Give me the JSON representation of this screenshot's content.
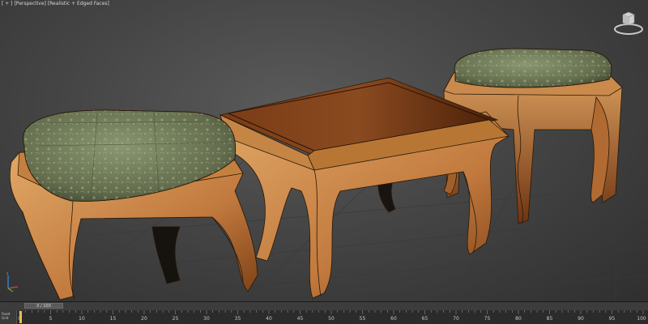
{
  "viewport": {
    "label_parts": [
      "[ + ]",
      "[Perspective]",
      "[Realistic + Edged Faces]"
    ],
    "background": "#454545",
    "colors": {
      "wood_light": "#d49a5c",
      "wood_dark": "#7a3e16",
      "tabletop": "#6a3414",
      "cushion": "#6f7a58",
      "edge_lines": "#1e1208"
    }
  },
  "viewcube": {
    "icon": "viewcube-icon"
  },
  "axis_tripod": {
    "icon": "axis-tripod-icon"
  },
  "time_slider": {
    "label": "0 / 100",
    "current_frame": 0,
    "total_frames": 100
  },
  "trackbar": {
    "left_label": "Fixed Grid",
    "ticks": [
      "0",
      "5",
      "10",
      "15",
      "20",
      "25",
      "30",
      "35",
      "40",
      "45",
      "50",
      "55",
      "60",
      "65",
      "70",
      "75",
      "80",
      "85",
      "90",
      "95",
      "100"
    ],
    "playhead_color": "#e8c04a"
  }
}
